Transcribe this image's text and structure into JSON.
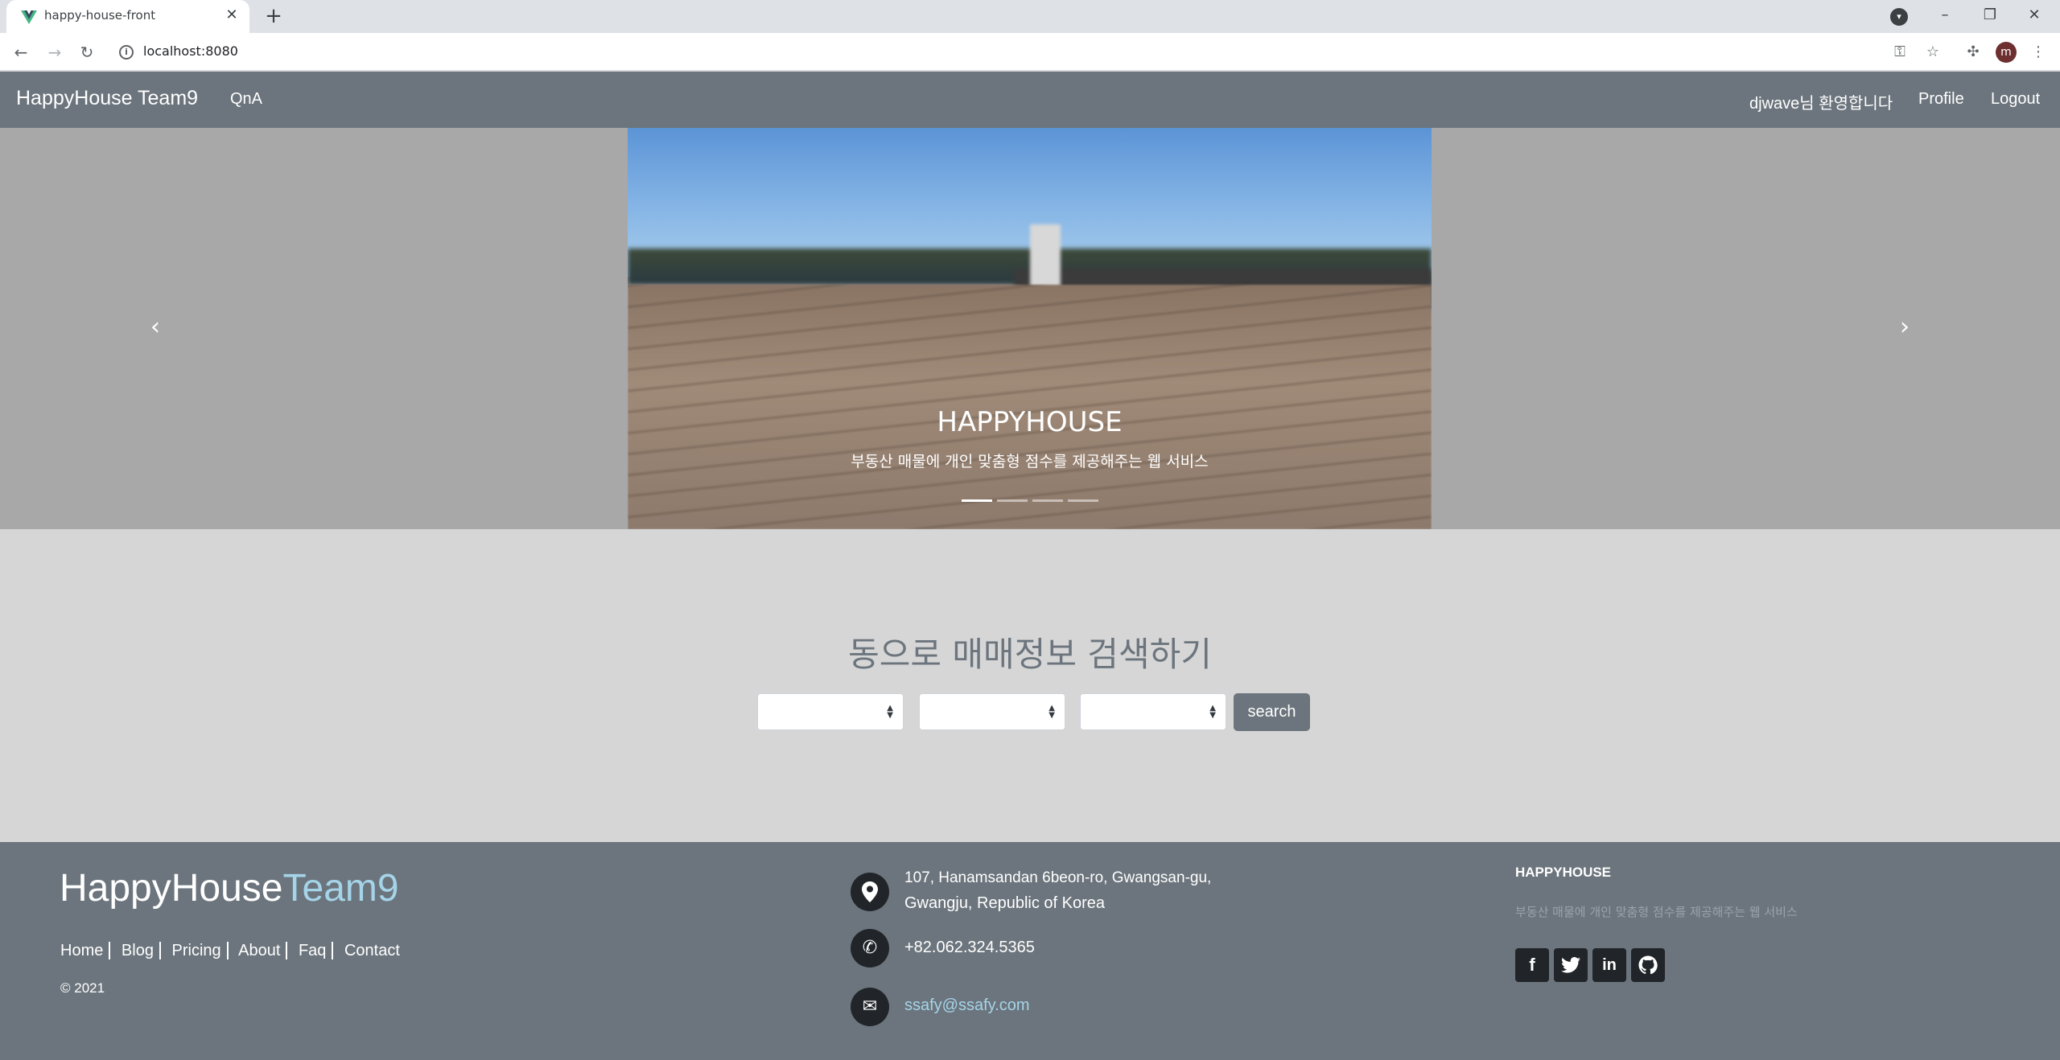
{
  "browser": {
    "tab_title": "happy-house-front",
    "url": "localhost:8080",
    "profile_initial": "m"
  },
  "navbar": {
    "brand": "HappyHouse Team9",
    "qna": "QnA",
    "welcome": "djwave님 환영합니다",
    "profile": "Profile",
    "logout": "Logout"
  },
  "carousel": {
    "title": "HAPPYHOUSE",
    "text": "부동산 매물에 개인 맞춤형 점수를 제공해주는 웹 서비스",
    "prev_icon": "chevron-left",
    "next_icon": "chevron-right",
    "slide_count": 4,
    "active_index": 0
  },
  "search": {
    "title": "동으로 매매정보 검색하기",
    "selects": [
      "",
      "",
      ""
    ],
    "button": "search"
  },
  "footer": {
    "brand_main": "HappyHouse",
    "brand_accent": "Team9",
    "links": [
      "Home",
      "Blog",
      "Pricing",
      "About",
      "Faq",
      "Contact"
    ],
    "copyright": "© 2021",
    "address_line1": "107, Hanamsandan 6beon-ro, Gwangsan-gu,",
    "address_line2": "Gwangju, Republic of Korea",
    "phone": "+82.062.324.5365",
    "email": "ssafy@ssafy.com",
    "about_title": "HAPPYHOUSE",
    "about_text": "부동산 매물에 개인 맞춤형 점수를 제공해주는 웹 서비스",
    "social": [
      "facebook",
      "twitter",
      "linkedin",
      "github"
    ]
  },
  "colors": {
    "navbar": "#6c757d",
    "carousel_bg": "#a8a8a8",
    "page_bg": "#d6d6d6",
    "footer": "#6c757d",
    "accent": "#a5d4e8"
  }
}
